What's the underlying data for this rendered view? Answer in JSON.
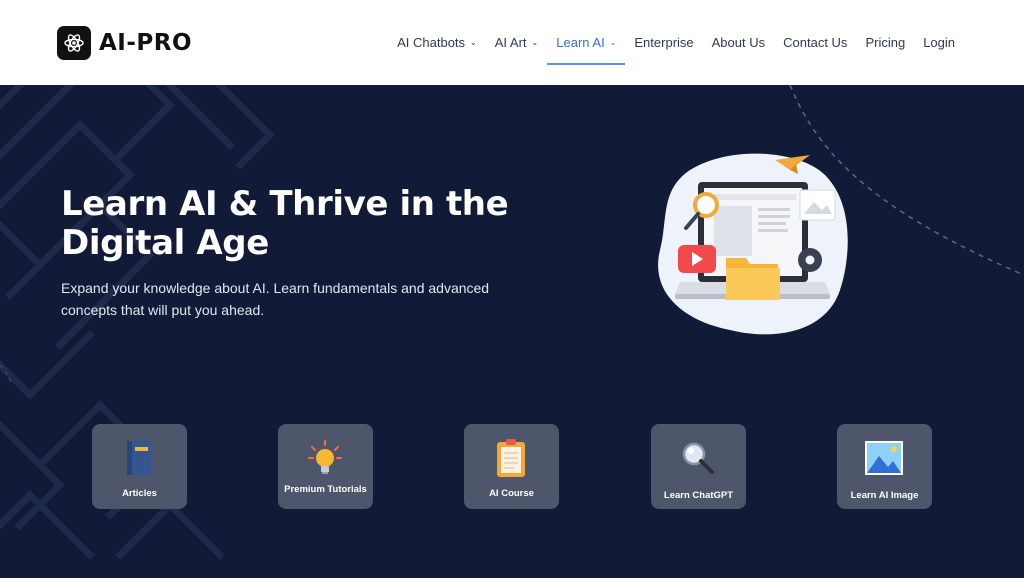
{
  "header": {
    "logo_text": "AI-PRO",
    "nav": [
      {
        "label": "AI Chatbots",
        "dropdown": true,
        "active": false
      },
      {
        "label": "AI Art",
        "dropdown": true,
        "active": false
      },
      {
        "label": "Learn AI",
        "dropdown": true,
        "active": true
      },
      {
        "label": "Enterprise",
        "dropdown": false,
        "active": false
      },
      {
        "label": "About Us",
        "dropdown": false,
        "active": false
      },
      {
        "label": "Contact Us",
        "dropdown": false,
        "active": false
      },
      {
        "label": "Pricing",
        "dropdown": false,
        "active": false
      },
      {
        "label": "Login",
        "dropdown": false,
        "active": false
      }
    ],
    "dropdown_glyph": "⌄"
  },
  "hero": {
    "title": "Learn AI & Thrive in the Digital Age",
    "subtitle": "Expand your knowledge about AI. Learn fundamentals and advanced concepts that will put you ahead."
  },
  "categories": [
    {
      "label": "Articles",
      "icon": "book-icon"
    },
    {
      "label": "Premium Tutorials",
      "icon": "lightbulb-icon"
    },
    {
      "label": "AI Course",
      "icon": "clipboard-icon"
    },
    {
      "label": "Learn ChatGPT",
      "icon": "magnifier-icon"
    },
    {
      "label": "Learn AI Image",
      "icon": "image-icon"
    }
  ],
  "colors": {
    "background": "#111a37",
    "header_bg": "#ffffff",
    "nav_text": "#2e3a55",
    "nav_active": "#2f6fe4",
    "card_bg": "#4d566b"
  }
}
